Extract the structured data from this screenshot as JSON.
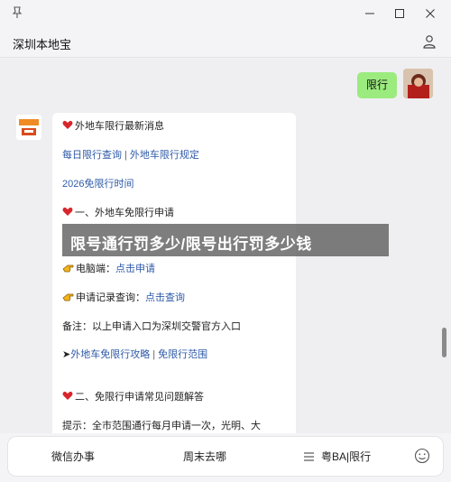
{
  "window": {
    "title": "深圳本地宝"
  },
  "chat": {
    "user_message": "限行",
    "bot": {
      "lines": {
        "heading1": "外地车限行最新消息",
        "link1a": "每日限行查询",
        "divider": "|",
        "link1b": "外地车限行规定",
        "link2": "2026免限行时间",
        "heading2": "一、外地车免限行申请",
        "pc_prefix": "电脑端：",
        "pc_link": "点击申请",
        "record_prefix": "申请记录查询：",
        "record_link": "点击查询",
        "note": "备注：以上申请入口为深圳交警官方入口",
        "arrow": "➤",
        "link3a": "外地车免限行攻略",
        "link3b": "免限行范围",
        "heading3": "二、免限行申请常见问题解答",
        "tip": "提示：全市范围通行每月申请一次，光明、大"
      }
    }
  },
  "overlay_banner": "限号通行罚多少/限号出行罚多少钱",
  "bottom_menu": {
    "item1": "微信办事",
    "item2": "周末去哪",
    "item3": "粤BA|限行"
  },
  "icons": {
    "pin": "pin-icon",
    "minimize": "minimize-icon",
    "maximize": "maximize-icon",
    "close": "close-icon",
    "user": "user-icon",
    "heart": "heart-icon",
    "hand": "pointing-hand-icon",
    "menu": "menu-icon",
    "emoji": "smile-icon"
  },
  "colors": {
    "user_bubble": "#9beb7e",
    "link": "#2e5aa8",
    "heart": "#d8262c"
  }
}
